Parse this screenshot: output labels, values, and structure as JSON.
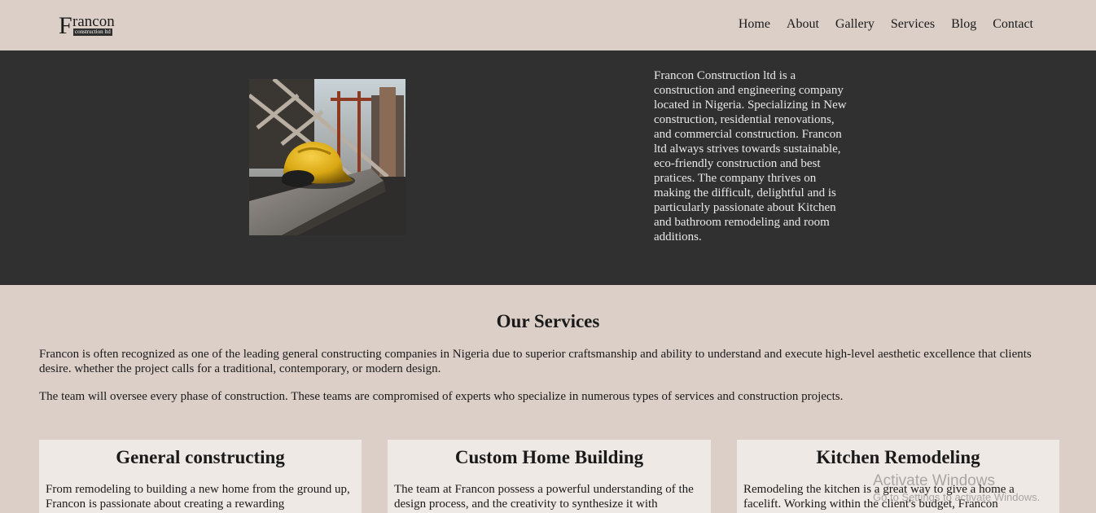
{
  "header": {
    "logo": {
      "letter": "F",
      "word": "rancon",
      "tagline": "construction ltd"
    },
    "nav": [
      "Home",
      "About",
      "Gallery",
      "Services",
      "Blog",
      "Contact"
    ]
  },
  "hero": {
    "image_icon": "hard-hat-photo",
    "text": "Francon Construction ltd is a construction and engineering company located in Nigeria. Specializing in New construction, residential renovations, and commercial construction. Francon ltd always strives towards sustainable, eco-friendly construction and best pratices. The company thrives on making the difficult, delightful and is particularly passionate about Kitchen and bathroom remodeling and room additions."
  },
  "services": {
    "title": "Our Services",
    "paragraph1": "Francon is often recognized as one of the leading general constructing companies in Nigeria due to superior craftsmanship and ability to understand and execute high-level aesthetic excellence that clients desire. whether the project calls for a traditional, contemporary, or modern design.",
    "paragraph2": "The team will oversee every phase of construction. These teams are compromised of experts who specialize in numerous types of services and construction projects.",
    "cards": [
      {
        "title": "General constructing",
        "text": "From remodeling to building a new home from the ground up, Francon is passionate about creating a rewarding"
      },
      {
        "title": "Custom Home Building",
        "text": "The team at Francon possess a powerful understanding of the design process, and the creativity to synthesize it with"
      },
      {
        "title": "Kitchen Remodeling",
        "text": "Remodeling the kitchen is a great way to give a home a facelift. Working within the client's budget, Francon"
      }
    ]
  },
  "watermark": {
    "line1": "Activate Windows",
    "line2": "Go to Settings to activate Windows."
  },
  "colors": {
    "background": "#dccfc7",
    "hero": "#303030",
    "card": "#efe9e6"
  }
}
